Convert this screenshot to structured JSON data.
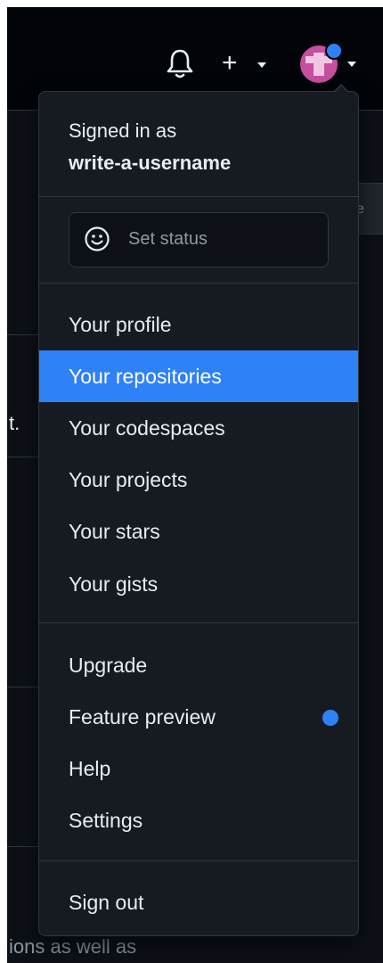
{
  "header": {
    "notifications_icon": "bell-icon",
    "create_icon": "plus-icon",
    "avatar_badge_color": "#2f81f7"
  },
  "background": {
    "button_text": "e",
    "text_fragment_1": "t.",
    "text_fragment_bottom": "ions as well as"
  },
  "dropdown": {
    "signed_in_label": "Signed in as",
    "username": "write-a-username",
    "set_status_label": "Set status",
    "section_profile": [
      {
        "label": "Your profile",
        "active": false
      },
      {
        "label": "Your repositories",
        "active": true
      },
      {
        "label": "Your codespaces",
        "active": false
      },
      {
        "label": "Your projects",
        "active": false
      },
      {
        "label": "Your stars",
        "active": false
      },
      {
        "label": "Your gists",
        "active": false
      }
    ],
    "section_account": [
      {
        "label": "Upgrade"
      },
      {
        "label": "Feature preview",
        "badge": true
      },
      {
        "label": "Help"
      },
      {
        "label": "Settings"
      }
    ],
    "sign_out_label": "Sign out"
  },
  "colors": {
    "accent": "#2f81f7",
    "menu_bg": "#161b22",
    "border": "#30363d",
    "text": "#e6edf3"
  }
}
